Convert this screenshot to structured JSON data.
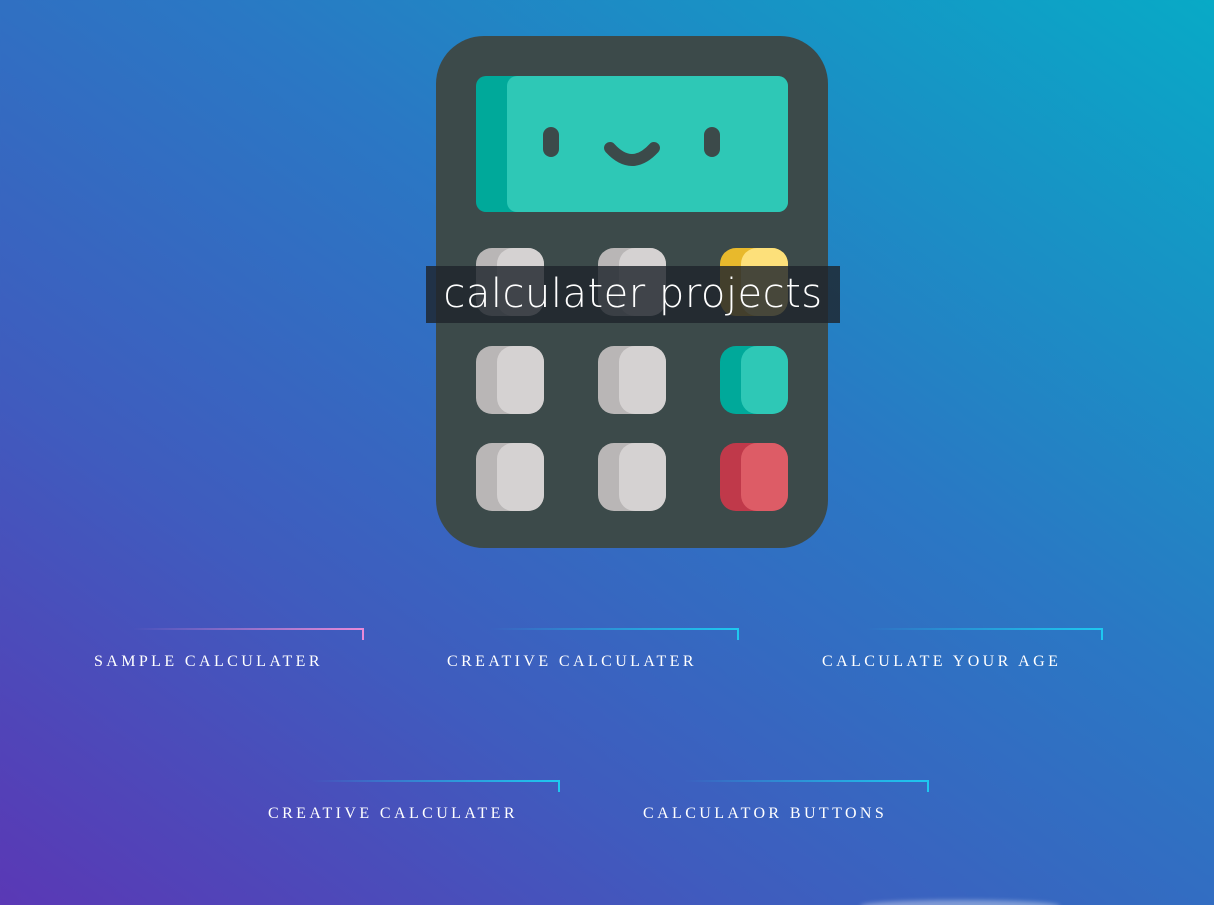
{
  "hero": {
    "title": "calculater projects",
    "illustration": "smiling-calculator-icon"
  },
  "links": [
    {
      "label": "SAMPLE CALCULATER",
      "accent": "#e88ad8"
    },
    {
      "label": "CREATIVE CALCULATER",
      "accent": "#1ec8f0"
    },
    {
      "label": "CALCULATE YOUR AGE",
      "accent": "#1ec8f0"
    },
    {
      "label": "CREATIVE CALCULATER",
      "accent": "#1ec8f0"
    },
    {
      "label": "CALCULATOR BUTTONS",
      "accent": "#1ec8f0"
    }
  ],
  "colors": {
    "background_start": "#5a38b5",
    "background_end": "#08aac6",
    "calculator_body": "#3c4a4a",
    "screen": "#2ec8b6",
    "key_gray": "#d5d2d2",
    "key_yellow": "#fde07a",
    "key_teal": "#2ec8b6",
    "key_red": "#dd5c66"
  }
}
